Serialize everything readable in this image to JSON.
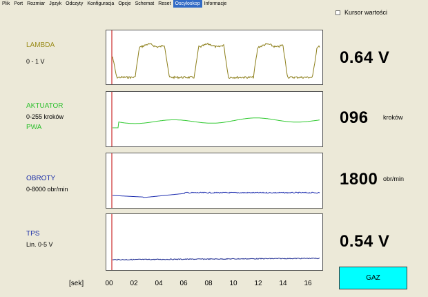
{
  "menu": [
    "Plik",
    "Port",
    "Rozmiar",
    "Język",
    "Odczyty",
    "Konfiguracja",
    "Opcje",
    "Schemat",
    "Reset",
    "Oscyloskop",
    "Informacje"
  ],
  "active_menu": "Oscyloskop",
  "cursor_toggle": {
    "label": "Kursor wartości",
    "checked": false
  },
  "channels": [
    {
      "id": "lambda",
      "name": "LAMBDA",
      "range": "0 - 1 V",
      "value": "0.64 V",
      "unit": "",
      "color": "#8b7d17",
      "name_color": "#9b8d1c"
    },
    {
      "id": "aktuator",
      "name": "AKTUATOR",
      "range": "0-255 kroków",
      "extra_name": "PWA",
      "value": "096",
      "unit": "kroków",
      "color": "#2fc92f",
      "name_color": "#30c030"
    },
    {
      "id": "obroty",
      "name": "OBROTY",
      "range": "0-8000 obr/min",
      "value": "1800",
      "unit": "obr/min",
      "color": "#2030b0",
      "name_color": "#1c2fa8"
    },
    {
      "id": "tps",
      "name": "TPS",
      "range": "Lin. 0-5 V",
      "value": "0.54 V",
      "unit": "",
      "color": "#1c2a90",
      "name_color": "#1c2fa8"
    }
  ],
  "time_axis": {
    "title": "[sek]",
    "ticks": [
      "00",
      "02",
      "04",
      "06",
      "08",
      "10",
      "12",
      "14",
      "16"
    ]
  },
  "gaz_button": {
    "label": "GAZ",
    "color": "#00ffff"
  },
  "marker_color": "#c00000"
}
